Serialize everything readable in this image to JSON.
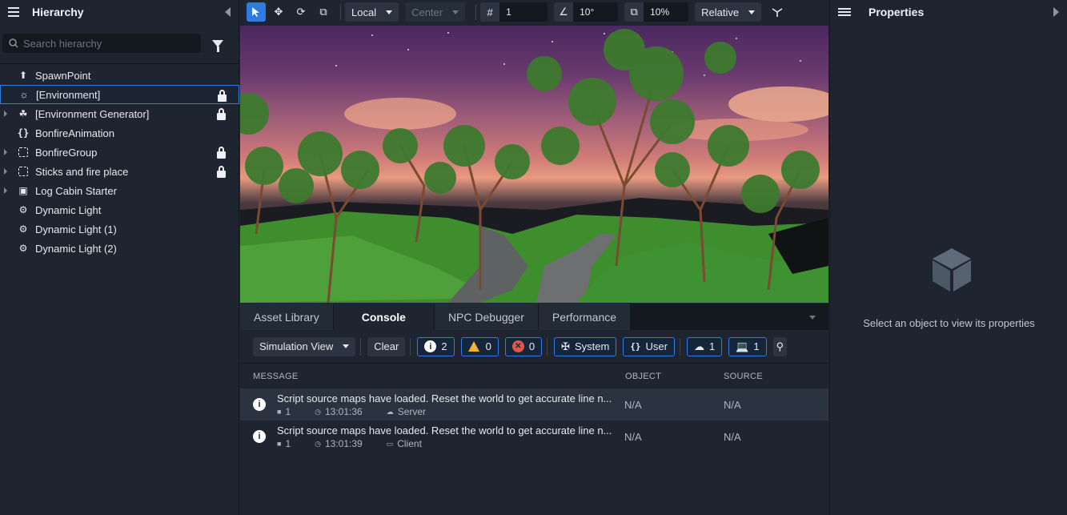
{
  "hierarchy": {
    "title": "Hierarchy",
    "search_placeholder": "Search hierarchy",
    "items": [
      {
        "label": "SpawnPoint",
        "icon": "spawn-point-icon",
        "expandable": false,
        "locked": false,
        "selected": false
      },
      {
        "label": "[Environment]",
        "icon": "environment-sun-icon",
        "expandable": false,
        "locked": true,
        "selected": true
      },
      {
        "label": "[Environment Generator]",
        "icon": "environment-generator-icon",
        "expandable": true,
        "locked": true,
        "selected": false
      },
      {
        "label": "BonfireAnimation",
        "icon": "script-braces-icon",
        "expandable": false,
        "locked": false,
        "selected": false
      },
      {
        "label": "BonfireGroup",
        "icon": "group-dashed-icon",
        "expandable": true,
        "locked": true,
        "selected": false
      },
      {
        "label": "Sticks and fire place",
        "icon": "group-dashed-icon",
        "expandable": true,
        "locked": true,
        "selected": false
      },
      {
        "label": "Log Cabin Starter",
        "icon": "asset-template-icon",
        "expandable": true,
        "locked": false,
        "selected": false
      },
      {
        "label": "Dynamic Light",
        "icon": "dynamic-light-icon",
        "expandable": false,
        "locked": false,
        "selected": false
      },
      {
        "label": "Dynamic Light (1)",
        "icon": "dynamic-light-icon",
        "expandable": false,
        "locked": false,
        "selected": false
      },
      {
        "label": "Dynamic Light (2)",
        "icon": "dynamic-light-icon",
        "expandable": false,
        "locked": false,
        "selected": false
      }
    ]
  },
  "toolbar": {
    "space_mode": "Local",
    "pivot_mode": "Center",
    "grid_snap": "1",
    "rotation_snap": "10°",
    "scale_snap": "10%",
    "relative_mode": "Relative"
  },
  "bottom": {
    "tabs": [
      "Asset Library",
      "Console",
      "NPC Debugger",
      "Performance"
    ],
    "active_tab": "Console",
    "view_mode": "Simulation View",
    "clear_label": "Clear",
    "info_count": "2",
    "warning_count": "0",
    "error_count": "0",
    "system_label": "System",
    "user_label": "User",
    "server_count": "1",
    "client_count": "1",
    "columns": {
      "message": "MESSAGE",
      "object": "OBJECT",
      "source": "SOURCE"
    },
    "logs": [
      {
        "message": "Script source maps have loaded. Reset the world to get accurate line n...",
        "count": "1",
        "time": "13:01:36",
        "origin": "Server",
        "object": "N/A",
        "source": "N/A"
      },
      {
        "message": "Script source maps have loaded. Reset the world to get accurate line n...",
        "count": "1",
        "time": "13:01:39",
        "origin": "Client",
        "object": "N/A",
        "source": "N/A"
      }
    ]
  },
  "properties": {
    "title": "Properties",
    "empty_message": "Select an object to view its properties"
  },
  "colors": {
    "accent": "#2f7be0",
    "panel": "#1e2530",
    "warning": "#f2b233",
    "error": "#e0584a"
  }
}
